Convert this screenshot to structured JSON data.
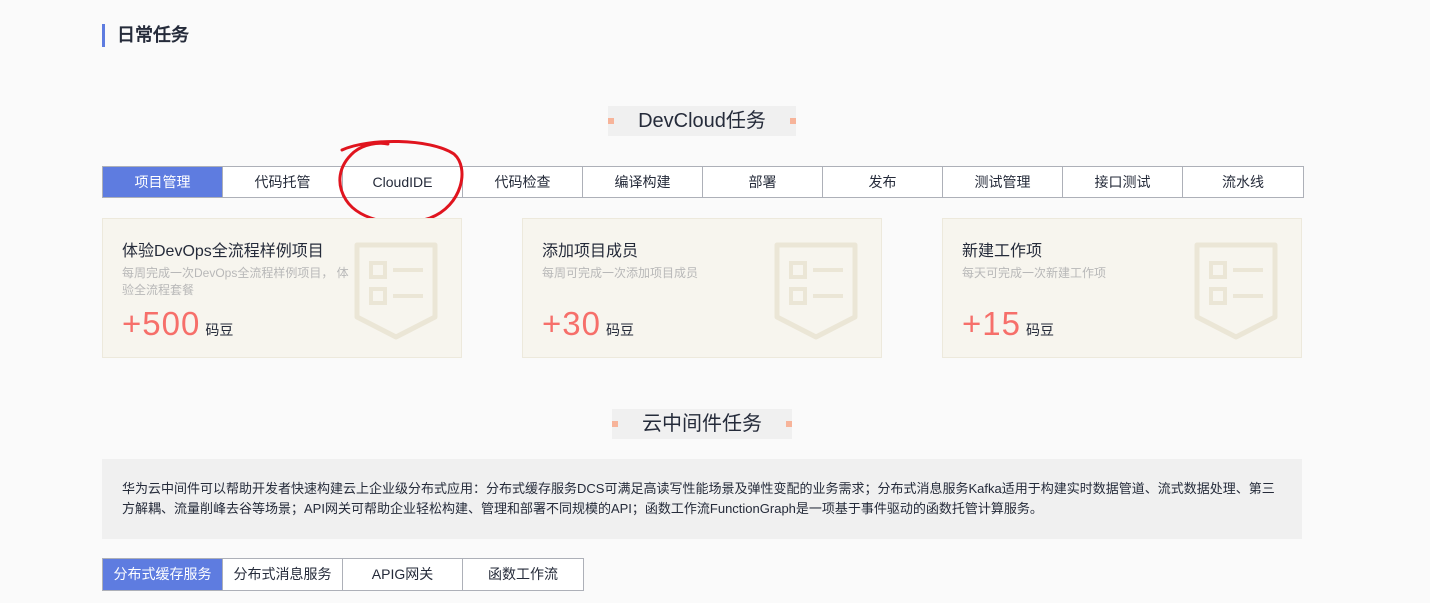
{
  "section": {
    "title": "日常任务"
  },
  "devcloud": {
    "title": "DevCloud任务",
    "tabs": [
      {
        "label": "项目管理",
        "active": true
      },
      {
        "label": "代码托管"
      },
      {
        "label": "CloudIDE"
      },
      {
        "label": "代码检查"
      },
      {
        "label": "编译构建"
      },
      {
        "label": "部署"
      },
      {
        "label": "发布"
      },
      {
        "label": "测试管理"
      },
      {
        "label": "接口测试"
      },
      {
        "label": "流水线"
      }
    ],
    "cards": [
      {
        "title": "体验DevOps全流程样例项目",
        "desc": "每周完成一次DevOps全流程样例项目， 体验全流程套餐",
        "points": "+500",
        "unit": "码豆",
        "icon": "task-list-icon"
      },
      {
        "title": "添加项目成员",
        "desc": "每周可完成一次添加项目成员",
        "points": "+30",
        "unit": "码豆",
        "icon": "task-list-icon"
      },
      {
        "title": "新建工作项",
        "desc": "每天可完成一次新建工作项",
        "points": "+15",
        "unit": "码豆",
        "icon": "task-list-icon"
      }
    ]
  },
  "middleware": {
    "title": "云中间件任务",
    "description": "华为云中间件可以帮助开发者快速构建云上企业级分布式应用：分布式缓存服务DCS可满足高读写性能场景及弹性变配的业务需求；分布式消息服务Kafka适用于构建实时数据管道、流式数据处理、第三方解耦、流量削峰去谷等场景；API网关可帮助企业轻松构建、管理和部署不同规模的API；函数工作流FunctionGraph是一项基于事件驱动的函数托管计算服务。",
    "tabs": [
      {
        "label": "分布式缓存服务",
        "active": true
      },
      {
        "label": "分布式消息服务"
      },
      {
        "label": "APIG网关"
      },
      {
        "label": "函数工作流"
      }
    ]
  },
  "colors": {
    "accent": "#5e7ce0",
    "points": "#f66f6a",
    "annotation": "#e0141e",
    "dot": "#f7b49a"
  }
}
